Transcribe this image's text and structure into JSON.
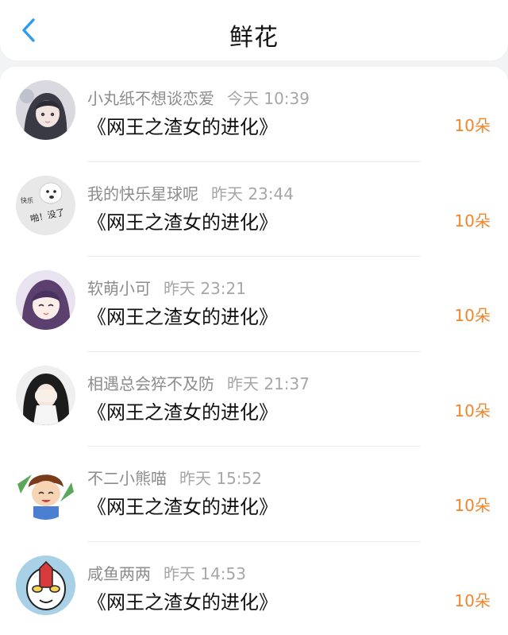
{
  "header": {
    "title": "鲜花",
    "back_icon": "chevron-left-icon"
  },
  "colors": {
    "accent_back": "#2e9bf0",
    "count_orange": "#f0862c"
  },
  "items": [
    {
      "user": "小丸纸不想谈恋爱",
      "time": "今天 10:39",
      "book": "《网王之渣女的进化》",
      "count": "10朵"
    },
    {
      "user": "我的快乐星球呢",
      "time": "昨天 23:44",
      "book": "《网王之渣女的进化》",
      "count": "10朵",
      "avatar_text": [
        "快乐",
        "啪！没了"
      ]
    },
    {
      "user": "软萌小可",
      "time": "昨天 23:21",
      "book": "《网王之渣女的进化》",
      "count": "10朵"
    },
    {
      "user": "相遇总会猝不及防",
      "time": "昨天 21:37",
      "book": "《网王之渣女的进化》",
      "count": "10朵"
    },
    {
      "user": "不二小熊喵",
      "time": "昨天 15:52",
      "book": "《网王之渣女的进化》",
      "count": "10朵"
    },
    {
      "user": "咸鱼两两",
      "time": "昨天 14:53",
      "book": "《网王之渣女的进化》",
      "count": "10朵"
    }
  ]
}
